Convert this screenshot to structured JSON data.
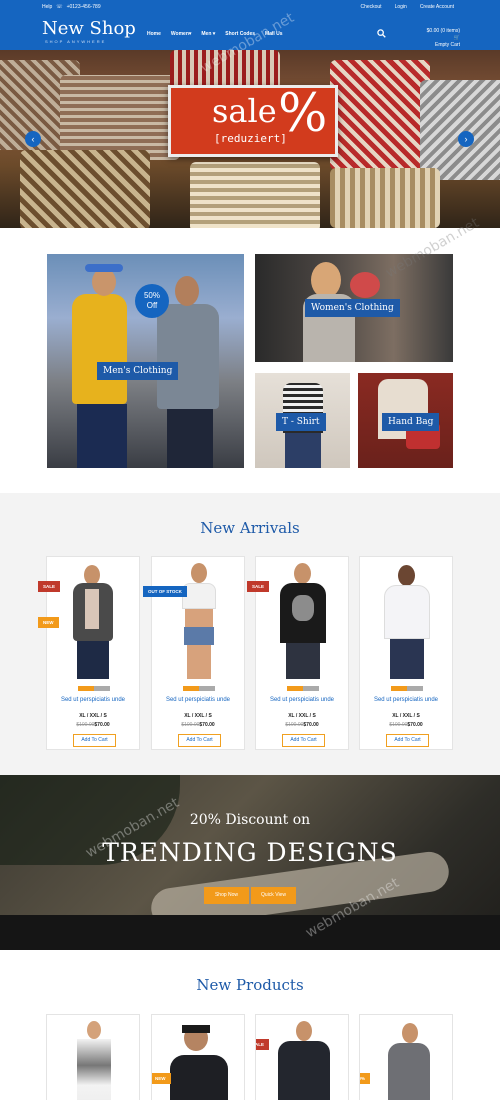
{
  "topbar": {
    "help": "Help",
    "phone": "+0123-456-789",
    "links": [
      "Checkout",
      "Login",
      "Create Account"
    ]
  },
  "brand": {
    "name": "New Shop",
    "tagline": "SHOP ANYWHERE"
  },
  "nav": [
    "Home",
    "Women",
    "Men",
    "Short Codes",
    "Mail Us"
  ],
  "cart": {
    "line1": "$0.00 (0 items)",
    "line2": "Empty Cart"
  },
  "hero": {
    "sign_main": "sale",
    "sign_symbol": "%",
    "sign_sub": "[reduziert]"
  },
  "categories": {
    "men": "Men's Clothing",
    "badge_line1": "50%",
    "badge_line2": "Off",
    "women": "Women's Clothing",
    "tshirt": "T - Shirt",
    "handbag": "Hand Bag"
  },
  "arrivals": {
    "title": "New Arrivals",
    "products": [
      {
        "name": "Sed ut perspiciatis unde",
        "sizes": "XL / XXL / S",
        "old_price": "$100.00",
        "price": "$70.00",
        "button": "Add To Cart",
        "ribbons": [
          "SALE",
          "NEW"
        ]
      },
      {
        "name": "Sed ut perspiciatis unde",
        "sizes": "XL / XXL / S",
        "old_price": "$100.00",
        "price": "$70.00",
        "button": "Add To Cart",
        "ribbons": [
          "OUT OF STOCK"
        ]
      },
      {
        "name": "Sed ut perspiciatis unde",
        "sizes": "XL / XXL / S",
        "old_price": "$100.00",
        "price": "$70.00",
        "button": "Add To Cart",
        "ribbons": [
          "SALE"
        ]
      },
      {
        "name": "Sed ut perspiciatis unde",
        "sizes": "XL / XXL / S",
        "old_price": "$100.00",
        "price": "$70.00",
        "button": "Add To Cart",
        "ribbons": []
      }
    ]
  },
  "discount": {
    "line1": "20% Discount on",
    "line2": "TRENDING DESIGNS",
    "btn1": "Shop Now",
    "btn2": "Quick View"
  },
  "new_products": {
    "title": "New Products",
    "ribbons": [
      "NEW",
      "SALE",
      "20%"
    ]
  },
  "watermark": "webmoban.net",
  "colors": {
    "primary": "#1565c0",
    "accent": "#f29a1a",
    "sale_red": "#c0392b"
  }
}
